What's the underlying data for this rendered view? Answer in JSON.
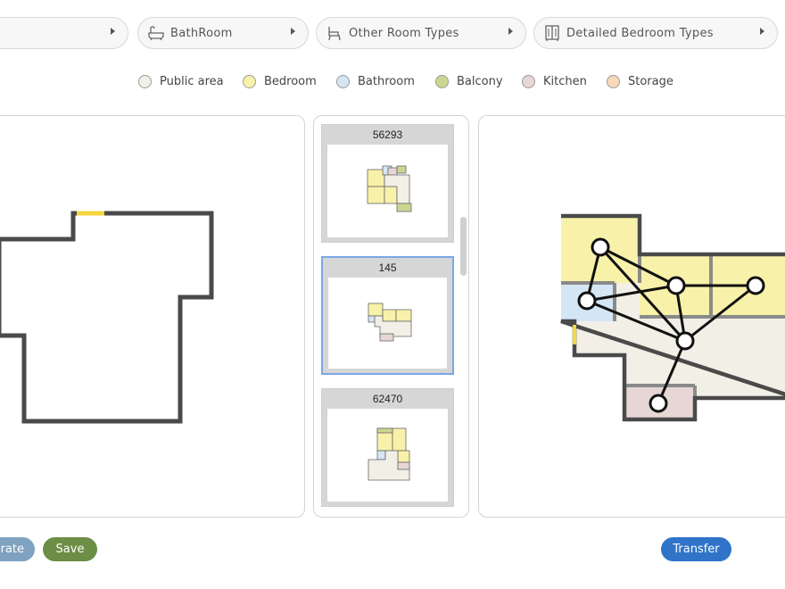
{
  "dropdowns": [
    {
      "label": "",
      "icon": "none"
    },
    {
      "label": "BathRoom",
      "icon": "bathtub-icon"
    },
    {
      "label": "Other Room Types",
      "icon": "chair-icon"
    },
    {
      "label": "Detailed Bedroom Types",
      "icon": "wardrobe-icon"
    }
  ],
  "legend": [
    {
      "label": "Public area",
      "color": "#f1efe6"
    },
    {
      "label": "Bedroom",
      "color": "#f8f1a9"
    },
    {
      "label": "Bathroom",
      "color": "#d4e6f4"
    },
    {
      "label": "Balcony",
      "color": "#cdd691"
    },
    {
      "label": "Kitchen",
      "color": "#e6d7d4"
    },
    {
      "label": "Storage",
      "color": "#f6d9b8"
    }
  ],
  "results": [
    {
      "id": "56293",
      "selected": false
    },
    {
      "id": "145",
      "selected": true
    },
    {
      "id": "62470",
      "selected": false
    }
  ],
  "buttons": {
    "generate": "erate",
    "save": "Save",
    "transfer": "Transfer"
  },
  "colors": {
    "wall": "#4a4a4a",
    "door": "#f4d73c",
    "generate_btn": "#7fa2c0",
    "save_btn": "#6c8e46",
    "transfer_btn": "#2f74c9",
    "selected_border": "#7aa7e6"
  }
}
